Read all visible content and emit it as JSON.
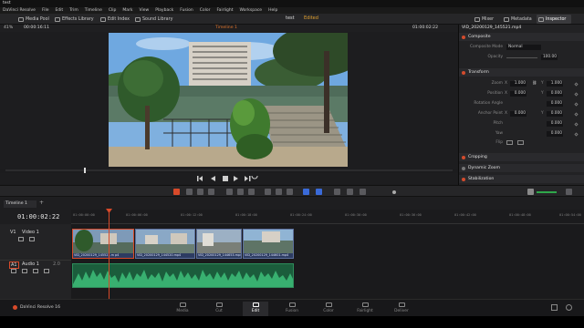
{
  "window": {
    "title": "test"
  },
  "menu": [
    "DaVinci Resolve",
    "File",
    "Edit",
    "Trim",
    "Timeline",
    "Clip",
    "Mark",
    "View",
    "Playback",
    "Fusion",
    "Color",
    "Fairlight",
    "Workspace",
    "Help"
  ],
  "toolbar": {
    "media_pool": "Media Pool",
    "effects_library": "Effects Library",
    "edit_index": "Edit Index",
    "sound_library": "Sound Library",
    "project_title": "test",
    "project_status": "Edited",
    "mixer": "Mixer",
    "metadata": "Metadata",
    "inspector": "Inspector"
  },
  "viewer": {
    "zoom": "41%",
    "source_timecode": "00:00:16:11",
    "timeline_name": "Timeline 1",
    "record_timecode": "01:00:02:22"
  },
  "inspector": {
    "clip_name": "VID_20200129_145521.mp4",
    "composite": {
      "header": "Composite",
      "mode_label": "Composite Mode",
      "mode_value": "Normal",
      "opacity_label": "Opacity",
      "opacity_value": "100.00"
    },
    "transform": {
      "header": "Transform",
      "zoom_label": "Zoom",
      "zoom_x_axis": "X",
      "zoom_x": "1.000",
      "zoom_y_axis": "Y",
      "zoom_y": "1.000",
      "position_label": "Position",
      "position_x_axis": "X",
      "position_x": "0.000",
      "position_y_axis": "Y",
      "position_y": "0.000",
      "rotation_label": "Rotation Angle",
      "rotation": "0.000",
      "anchor_label": "Anchor Point",
      "anchor_x_axis": "X",
      "anchor_x": "0.000",
      "anchor_y_axis": "Y",
      "anchor_y": "0.000",
      "pitch_label": "Pitch",
      "pitch": "0.000",
      "yaw_label": "Yaw",
      "yaw": "0.000",
      "flip_label": "Flip"
    },
    "cropping": "Cropping",
    "dynamic_zoom": "Dynamic Zoom",
    "stabilization": "Stabilization"
  },
  "timeline": {
    "tab_name": "Timeline 1",
    "timecode": "01:00:02:22",
    "ruler": [
      "01:00:00:00",
      "01:00:06:00",
      "01:00:12:00",
      "01:00:18:00",
      "01:00:24:00",
      "01:00:30:00",
      "01:00:36:00",
      "01:00:42:00",
      "01:00:48:00",
      "01:00:54:00"
    ],
    "video_track": {
      "id": "V1",
      "name": "Video 1"
    },
    "audio_track": {
      "id": "A1",
      "name": "Audio 1",
      "level": "2.0"
    },
    "clips": [
      "VID_20200129_145521.m p4",
      "VID_20200129_144520.mp4",
      "VID_20200129_144653.mp4",
      "VID_20200129_144601.mp4"
    ]
  },
  "pages": [
    "Media",
    "Cut",
    "Edit",
    "Fusion",
    "Color",
    "Fairlight",
    "Deliver"
  ],
  "active_page": "Edit",
  "footer": {
    "app_name": "DaVinci Resolve 16"
  },
  "colors": {
    "accent": "#d84a2a",
    "video_clip": "#3a4a70",
    "audio_clip": "#1b5d3c",
    "edited": "#e0a030"
  }
}
